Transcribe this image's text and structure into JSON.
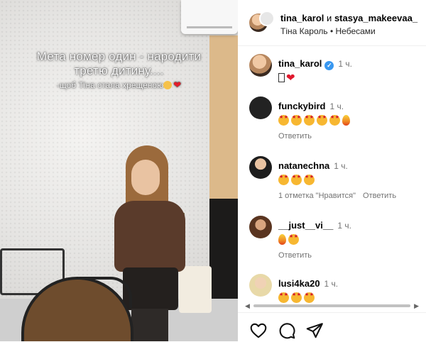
{
  "video": {
    "caption_line1": "Мета номер один - народити",
    "caption_line2": "третю дитину....",
    "caption_line3": "-щоб Тіна стала хрещеною"
  },
  "header": {
    "user1": "tina_karol",
    "conjunction": "и",
    "user2": "stasya_makeevaa_",
    "song": "Тіна Кароль • Небесами"
  },
  "comments": [
    {
      "user": "tina_karol",
      "time": "1 ч.",
      "verified": true
    },
    {
      "user": "funckybird",
      "time": "1 ч.",
      "reply": "Ответить"
    },
    {
      "user": "natanechna",
      "time": "1 ч.",
      "likes": "1 отметка \"Нравится\"",
      "reply": "Ответить"
    },
    {
      "user": "__just__vi__",
      "time": "1 ч.",
      "reply": "Ответить"
    },
    {
      "user": "lusi4ka20",
      "time": "1 ч."
    }
  ],
  "icons": {
    "like": "heart-outline-icon",
    "comment": "comment-bubble-icon",
    "share": "paper-plane-icon"
  },
  "colors": {
    "verified": "#3897f0",
    "heart": "#e0182d",
    "muted": "#737373"
  }
}
